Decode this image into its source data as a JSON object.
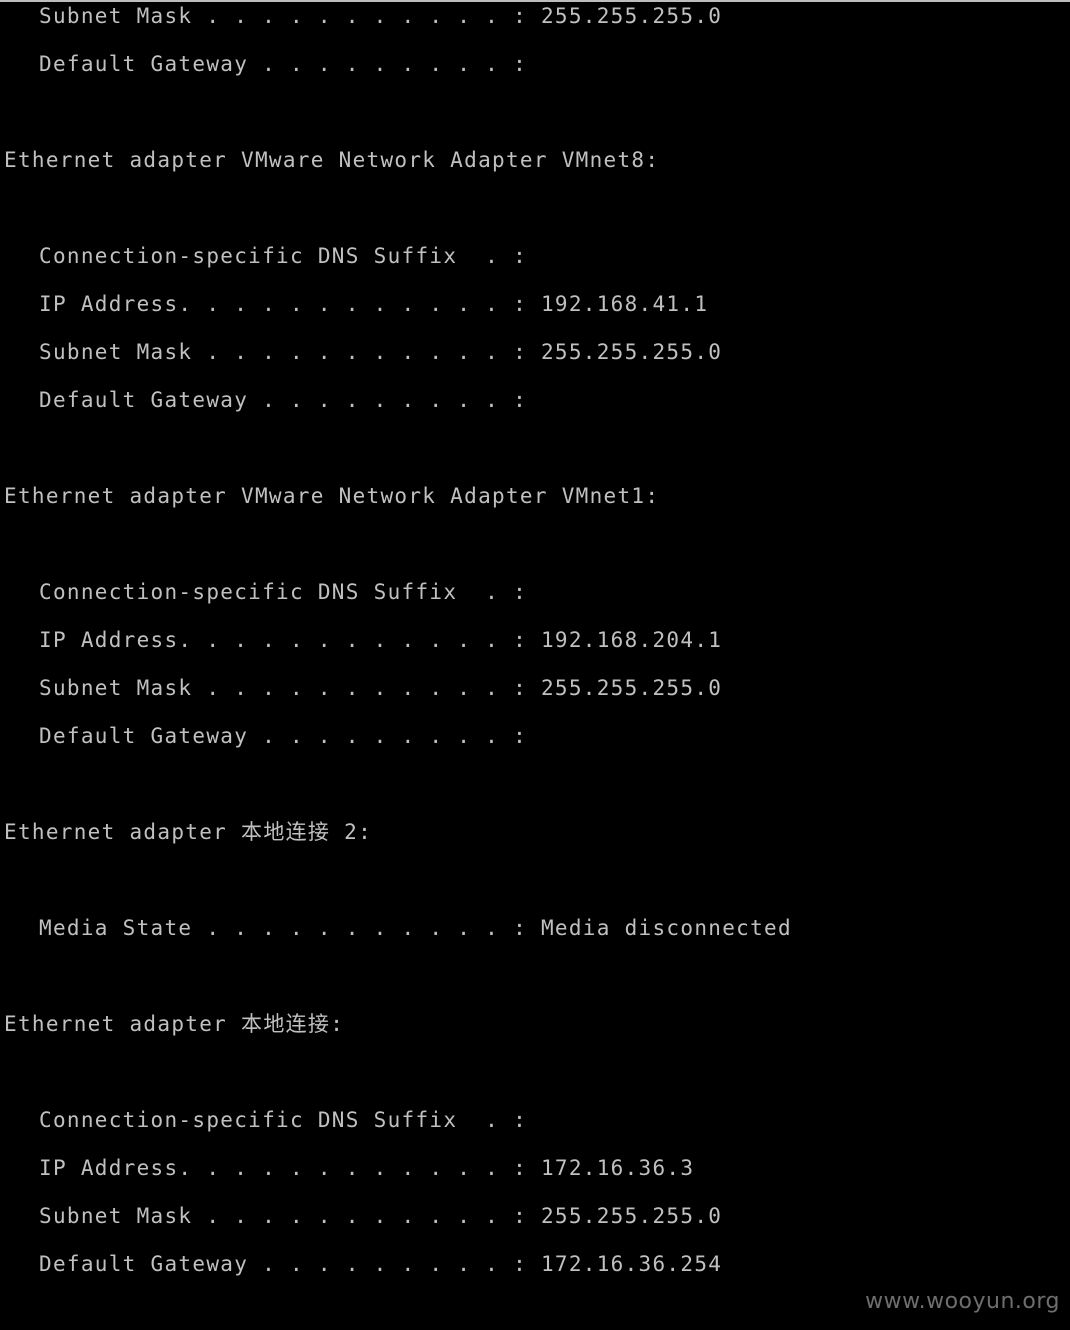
{
  "console": {
    "text_color": "#c0c0c0",
    "background_color": "#000000",
    "lines": [
      "Subnet Mask . . . . . . . . . . . : 255.255.255.0",
      "Default Gateway . . . . . . . . . :",
      "Ethernet adapter VMware Network Adapter VMnet8:",
      "Connection-specific DNS Suffix  . :",
      "IP Address. . . . . . . . . . . . : 192.168.41.1",
      "Subnet Mask . . . . . . . . . . . : 255.255.255.0",
      "Default Gateway . . . . . . . . . :",
      "Ethernet adapter VMware Network Adapter VMnet1:",
      "Connection-specific DNS Suffix  . :",
      "IP Address. . . . . . . . . . . . : 192.168.204.1",
      "Subnet Mask . . . . . . . . . . . : 255.255.255.0",
      "Default Gateway . . . . . . . . . :",
      "Ethernet adapter 本地连接 2:",
      "Media State . . . . . . . . . . . : Media disconnected",
      "Ethernet adapter 本地连接:",
      "Connection-specific DNS Suffix  . :",
      "IP Address. . . . . . . . . . . . : 172.16.36.3",
      "Subnet Mask . . . . . . . . . . . : 255.255.255.0",
      "Default Gateway . . . . . . . . . : 172.16.36.254"
    ]
  },
  "watermark": {
    "text": "www.wooyun.org"
  }
}
